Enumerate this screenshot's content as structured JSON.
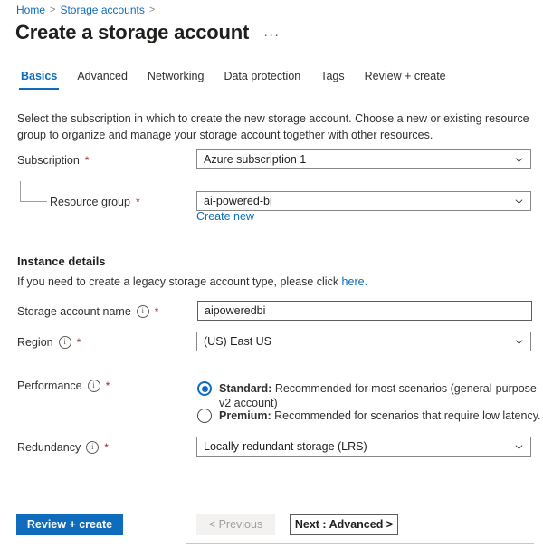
{
  "breadcrumb": {
    "items": [
      {
        "label": "Home",
        "separator": ">"
      },
      {
        "label": "Storage accounts",
        "separator": ">"
      }
    ]
  },
  "header": {
    "title": "Create a storage account",
    "more_menu": "···"
  },
  "tabs": [
    {
      "label": "Basics",
      "active": true
    },
    {
      "label": "Advanced",
      "active": false
    },
    {
      "label": "Networking",
      "active": false
    },
    {
      "label": "Data protection",
      "active": false
    },
    {
      "label": "Tags",
      "active": false
    },
    {
      "label": "Review + create",
      "active": false
    }
  ],
  "intro": "Select the subscription in which to create the new storage account. Choose a new or existing resource group to organize and manage your storage account together with other resources.",
  "form": {
    "subscription": {
      "label": "Subscription",
      "required": "*",
      "value": "Azure subscription 1"
    },
    "resource_group": {
      "label": "Resource group",
      "required": "*",
      "value": "ai-powered-bi",
      "create_new_link": "Create new"
    }
  },
  "instance_details": {
    "heading": "Instance details",
    "legacy_note_prefix": "If you need to create a legacy storage account type, please click ",
    "legacy_note_link": "here.",
    "storage_account_name": {
      "label": "Storage account name",
      "required": "*",
      "value": "aipoweredbi",
      "placeholder": ""
    },
    "region": {
      "label": "Region",
      "required": "*",
      "value": "(US) East US"
    },
    "performance": {
      "label": "Performance",
      "required": "*",
      "options": [
        {
          "name": "Standard:",
          "description": " Recommended for most scenarios (general-purpose v2 account)",
          "selected": true
        },
        {
          "name": "Premium:",
          "description": " Recommended for scenarios that require low latency.",
          "selected": false
        }
      ]
    },
    "redundancy": {
      "label": "Redundancy",
      "required": "*",
      "value": "Locally-redundant storage (LRS)"
    }
  },
  "footer": {
    "review_create": "Review + create",
    "previous": "< Previous",
    "next": "Next : Advanced >"
  },
  "colors": {
    "accent": "#0F6CBD",
    "required": "#a4262c",
    "text": "#323130",
    "border": "#8a8886"
  }
}
